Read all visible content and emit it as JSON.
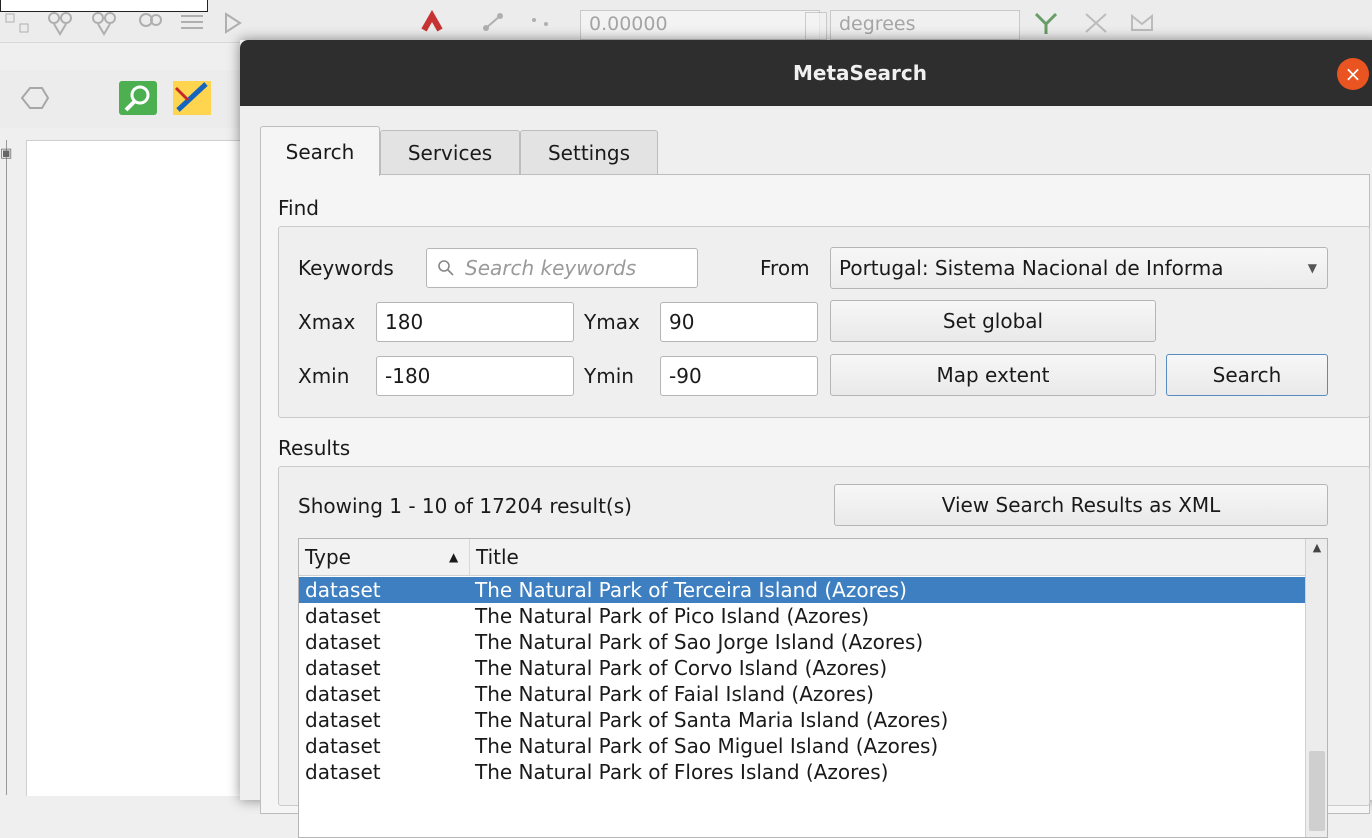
{
  "background": {
    "coord_value": "0.00000",
    "units_value": "degrees"
  },
  "dialog": {
    "title": "MetaSearch",
    "close_glyph": "×"
  },
  "tabs": [
    {
      "label": "Search",
      "active": true
    },
    {
      "label": "Services",
      "active": false
    },
    {
      "label": "Settings",
      "active": false
    }
  ],
  "find": {
    "section_label": "Find",
    "keywords_label": "Keywords",
    "keywords_placeholder": "Search keywords",
    "from_label": "From",
    "from_value": "Portugal: Sistema Nacional de Informa",
    "xmax_label": "Xmax",
    "xmax_value": "180",
    "ymax_label": "Ymax",
    "ymax_value": "90",
    "xmin_label": "Xmin",
    "xmin_value": "-180",
    "ymin_label": "Ymin",
    "ymin_value": "-90",
    "set_global_label": "Set global",
    "map_extent_label": "Map extent",
    "search_label": "Search"
  },
  "results": {
    "section_label": "Results",
    "summary": "Showing 1 - 10 of 17204 result(s)",
    "view_xml_label": "View Search Results as XML",
    "columns": [
      "Type",
      "Title"
    ],
    "sort_indicator": "▲",
    "rows": [
      {
        "type": "dataset",
        "title": "The Natural Park of Terceira Island (Azores)"
      },
      {
        "type": "dataset",
        "title": "The Natural Park of Pico Island (Azores)"
      },
      {
        "type": "dataset",
        "title": "The Natural Park of Sao Jorge Island (Azores)"
      },
      {
        "type": "dataset",
        "title": "The Natural Park of Corvo Island (Azores)"
      },
      {
        "type": "dataset",
        "title": "The Natural Park of Faial Island (Azores)"
      },
      {
        "type": "dataset",
        "title": "The Natural Park of Santa Maria Island (Azores)"
      },
      {
        "type": "dataset",
        "title": "The Natural Park of Sao Miguel Island (Azores)"
      },
      {
        "type": "dataset",
        "title": "The Natural Park of Flores Island (Azores)"
      }
    ],
    "selected_row": 0
  },
  "colors": {
    "titlebar": "#2e2e2e",
    "close_button": "#e95420",
    "selection": "#3d7fc1"
  }
}
